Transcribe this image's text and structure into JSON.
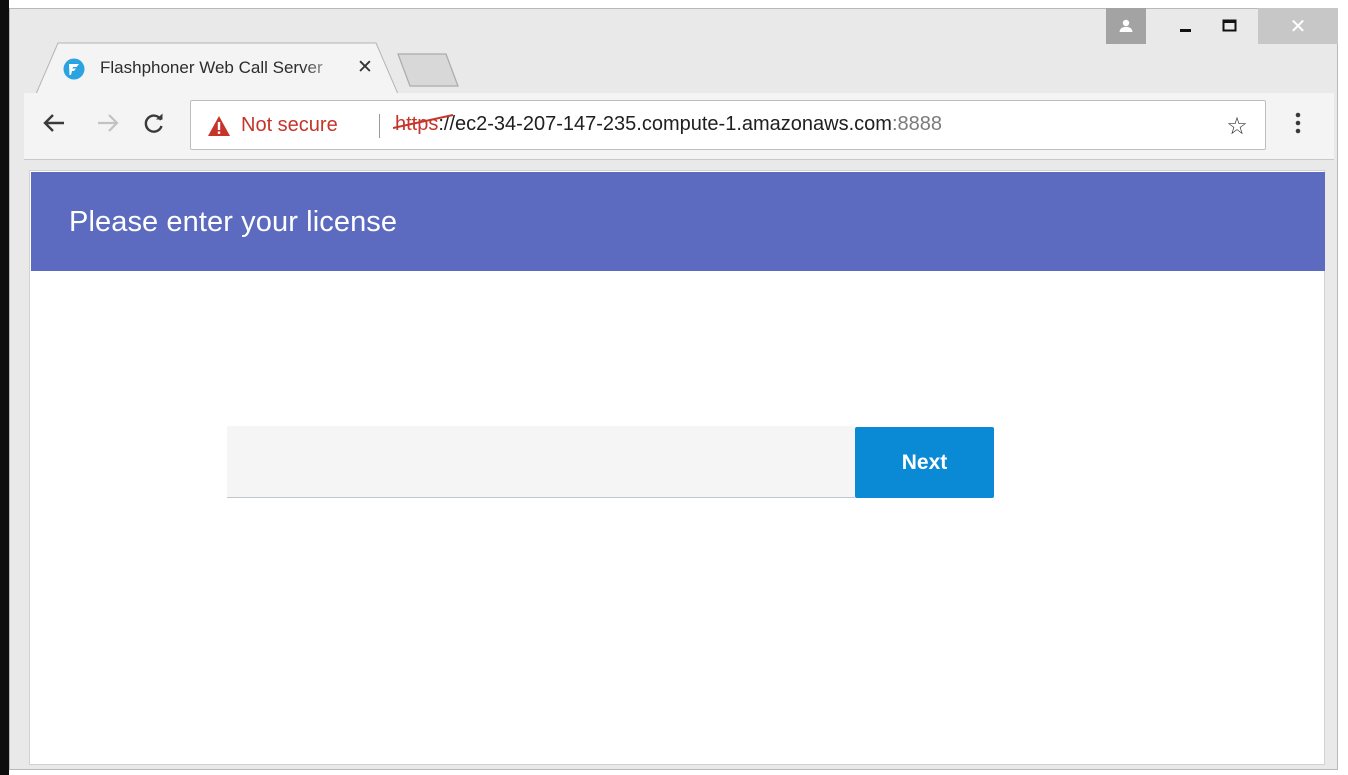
{
  "browser": {
    "tab": {
      "title": "Flashphoner Web Call Server",
      "close_glyph": "✕",
      "favicon": "flashphoner-logo-icon"
    },
    "window_controls": {
      "profile": "user-icon",
      "minimize": "minimize-icon",
      "maximize": "maximize-icon",
      "close": "✕"
    },
    "toolbar": {
      "back": "back-arrow-icon",
      "forward": "forward-arrow-icon",
      "reload": "reload-icon",
      "bookmark_glyph": "☆",
      "menu": "kebab-menu-icon"
    },
    "omnibox": {
      "security_label": "Not secure",
      "url_scheme": "https",
      "url_host": "://ec2-34-207-147-235.compute-1.amazonaws.com",
      "url_port": ":8888"
    }
  },
  "page": {
    "header_title": "Please enter your license",
    "license_input": {
      "value": "",
      "placeholder": ""
    },
    "next_button": "Next"
  },
  "colors": {
    "header": "#5c6bc0",
    "button": "#0a8ad5",
    "insecure": "#c5352b"
  }
}
